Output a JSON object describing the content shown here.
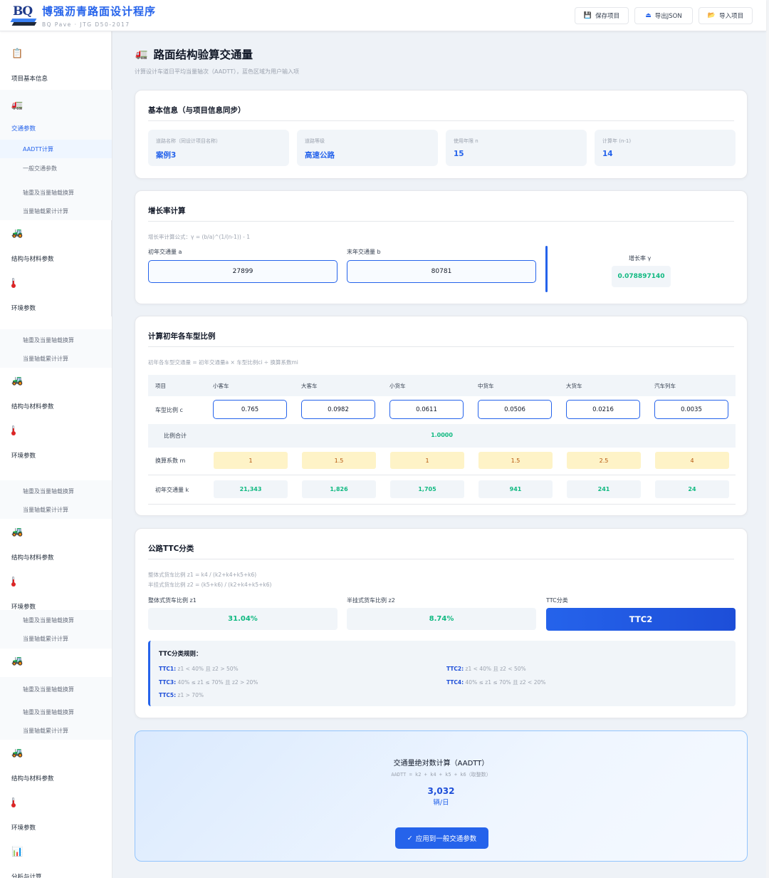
{
  "header": {
    "logo_text": "BQ",
    "title": "博强沥青路面设计程序",
    "subtitle": "BQ Pave · JTG D50-2017",
    "buttons": [
      {
        "icon": "save-icon",
        "glyph": "💾",
        "label": "保存项目"
      },
      {
        "icon": "export-icon",
        "glyph": "⏏",
        "label": "导出JSON"
      },
      {
        "icon": "folder-icon",
        "glyph": "📂",
        "label": "导入项目"
      }
    ]
  },
  "sidebar": {
    "project_info": "项目基本信息",
    "traffic": "交通参数",
    "aadtt_calc": "AADTT计算",
    "general_traffic": "一般交通参数",
    "axle_conversion": "轴重及当量轴载换算",
    "equiv_axle_cumulative": "当量轴载累计计算",
    "structure_material": "结构与材料参数",
    "environment": "环境参数",
    "analysis": "分析与计算"
  },
  "page": {
    "title": "路面结构验算交通量",
    "subtitle": "计算设计车道日平均当量轴次（AADTT），蓝色区域为用户输入项"
  },
  "basic_info": {
    "title": "基本信息（与项目信息同步）",
    "fields": [
      {
        "label": "道路名称（同设计项目名称）",
        "value": "案例3"
      },
      {
        "label": "道路等级",
        "value": "高速公路"
      },
      {
        "label": "使用年限 n",
        "value": "15"
      },
      {
        "label": "计算年 (n-1)",
        "value": "14"
      }
    ]
  },
  "growth": {
    "title": "增长率计算",
    "formula": "增长率计算公式：γ = (b/a)^(1/(n-1)) - 1",
    "a_label": "初年交通量 a",
    "a_value": "27899",
    "b_label": "末年交通量 b",
    "b_value": "80781",
    "rate_label": "增长率 γ",
    "rate_value": "0.078897140"
  },
  "vehicle_ratio": {
    "title": "计算初年各车型比例",
    "formula": "初年各车型交通量 = 初年交通量a × 车型比例ci ÷ 换算系数mi",
    "headers": [
      "项目",
      "小客车",
      "大客车",
      "小货车",
      "中货车",
      "大货车",
      "汽车列车"
    ],
    "ratio_label": "车型比例 c",
    "ratios": [
      "0.765",
      "0.0982",
      "0.0611",
      "0.0506",
      "0.0216",
      "0.0035"
    ],
    "sum_label": "比例合计",
    "sum_value": "1.0000",
    "coef_label": "换算系数 m",
    "coefs": [
      "1",
      "1.5",
      "1",
      "1.5",
      "2.5",
      "4"
    ],
    "k_label": "初年交通量 k",
    "k_values": [
      "21,343",
      "1,826",
      "1,705",
      "941",
      "241",
      "24"
    ]
  },
  "ttc": {
    "title": "公路TTC分类",
    "formula_z1": "整体式货车比例 z1 = k4 / (k2+k4+k5+k6)",
    "formula_z2": "半挂式货车比例 z2 = (k5+k6) / (k2+k4+k5+k6)",
    "z1_label": "整体式货车比例 z1",
    "z1_value": "31.04%",
    "z2_label": "半挂式货车比例 z2",
    "z2_value": "8.74%",
    "class_label": "TTC分类",
    "class_value": "TTC2",
    "rules_title": "TTC分类规则：",
    "rules": [
      {
        "name": "TTC1:",
        "text": "z1 < 40% 且 z2 > 50%"
      },
      {
        "name": "TTC2:",
        "text": "z1 < 40% 且 z2 < 50%"
      },
      {
        "name": "TTC3:",
        "text": "40% ≤ z1 ≤ 70% 且 z2 > 20%"
      },
      {
        "name": "TTC4:",
        "text": "40% ≤ z1 ≤ 70% 且 z2 < 20%"
      },
      {
        "name": "TTC5:",
        "text": "z1 > 70%"
      }
    ]
  },
  "aadtt": {
    "title": "交通量绝对数计算（AADTT）",
    "formula": "AADTT = k2 + k4 + k5 + k6（取整数）",
    "value": "3,032",
    "unit": "辆/日",
    "apply_label": "应用到一般交通参数",
    "apply_glyph": "✓"
  },
  "colors": {
    "accent": "#2563eb",
    "success": "#10b981",
    "coef_bg": "#fef3c7",
    "coef_text": "#b45309"
  }
}
